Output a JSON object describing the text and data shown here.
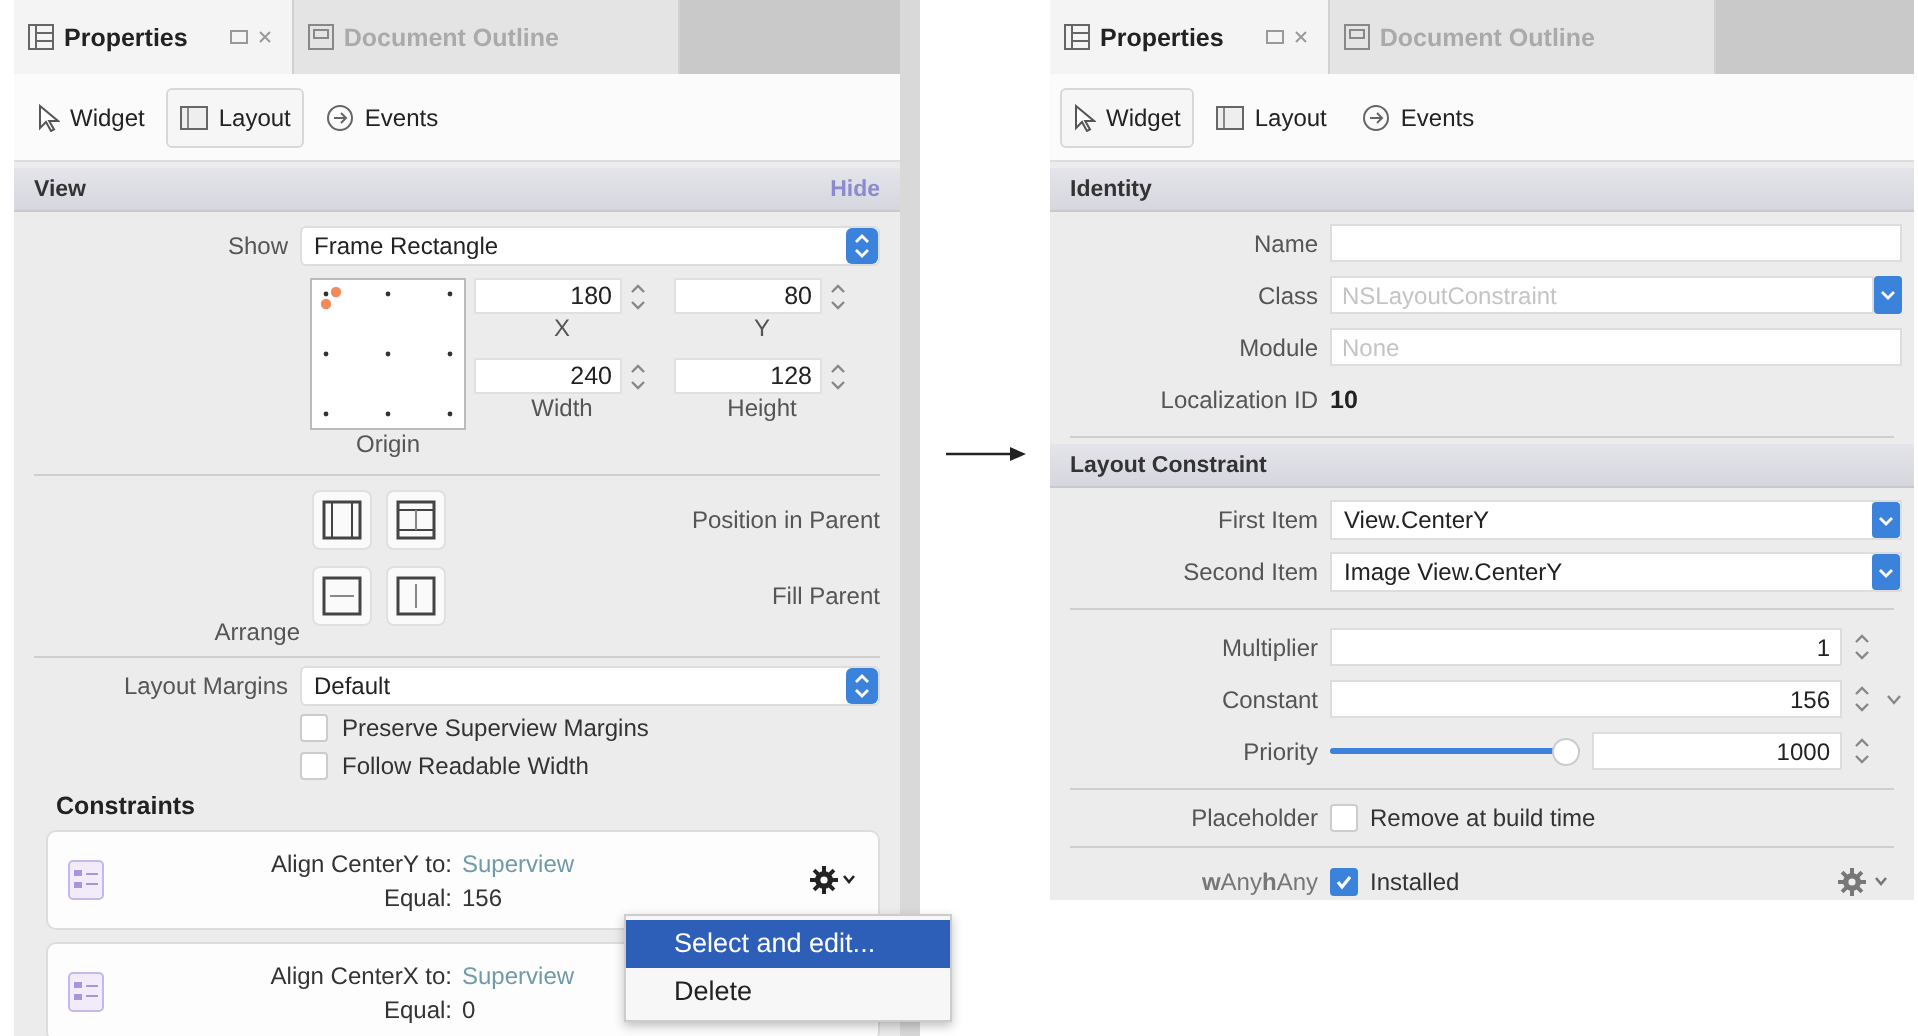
{
  "left_panel": {
    "tabs": [
      {
        "label": "Properties",
        "selected": true
      },
      {
        "label": "Document Outline",
        "selected": false
      }
    ],
    "toolbar": [
      {
        "label": "Widget",
        "selected": false
      },
      {
        "label": "Layout",
        "selected": true
      },
      {
        "label": "Events",
        "selected": false
      }
    ],
    "section": {
      "title": "View",
      "action": "Hide"
    },
    "show": {
      "label": "Show",
      "value": "Frame Rectangle"
    },
    "frame_fields": [
      {
        "label": "X",
        "value": "180"
      },
      {
        "label": "Y",
        "value": "80"
      },
      {
        "label": "Width",
        "value": "240"
      },
      {
        "label": "Height",
        "value": "128"
      }
    ],
    "origin_label": "Origin",
    "arrange": {
      "label": "Arrange",
      "rows": [
        "Position in Parent",
        "Fill Parent"
      ]
    },
    "layout_margins": {
      "label": "Layout Margins",
      "value": "Default"
    },
    "options": [
      {
        "label": "Preserve Superview Margins",
        "checked": false
      },
      {
        "label": "Follow Readable Width",
        "checked": false
      }
    ],
    "constraints_title": "Constraints",
    "constraints": [
      {
        "title": "Align CenterY to:",
        "target": "Superview",
        "relation": "Equal:",
        "value": "156"
      },
      {
        "title": "Align CenterX to:",
        "target": "Superview",
        "relation": "Equal:",
        "value": "0"
      }
    ],
    "context_menu": [
      {
        "label": "Select and edit...",
        "selected": true
      },
      {
        "label": "Delete",
        "selected": false
      }
    ]
  },
  "right_panel": {
    "tabs": [
      {
        "label": "Properties",
        "selected": true
      },
      {
        "label": "Document Outline",
        "selected": false
      }
    ],
    "toolbar": [
      {
        "label": "Widget",
        "selected": true
      },
      {
        "label": "Layout",
        "selected": false
      },
      {
        "label": "Events",
        "selected": false
      }
    ],
    "identity": {
      "title": "Identity",
      "fields": [
        {
          "label": "Name",
          "kind": "text"
        },
        {
          "label": "Class",
          "kind": "select",
          "placeholder": "NSLayoutConstraint"
        },
        {
          "label": "Module",
          "kind": "text",
          "placeholder": "None"
        },
        {
          "label": "Localization ID",
          "kind": "static",
          "value": "10"
        }
      ]
    },
    "constraint": {
      "title": "Layout Constraint",
      "items": [
        {
          "label": "First Item",
          "value": "View.CenterY"
        },
        {
          "label": "Second Item",
          "value": "Image View.CenterY"
        }
      ],
      "multiplier": {
        "label": "Multiplier",
        "value": "1"
      },
      "constant": {
        "label": "Constant",
        "value": "156"
      },
      "priority": {
        "label": "Priority",
        "level": 1,
        "value": "1000"
      },
      "placeholder": {
        "label": "Placeholder",
        "option": "Remove at build time",
        "checked": false
      },
      "installed": {
        "size_class": "**w**Any**h**Any",
        "label": "Installed",
        "checked": true
      }
    }
  }
}
